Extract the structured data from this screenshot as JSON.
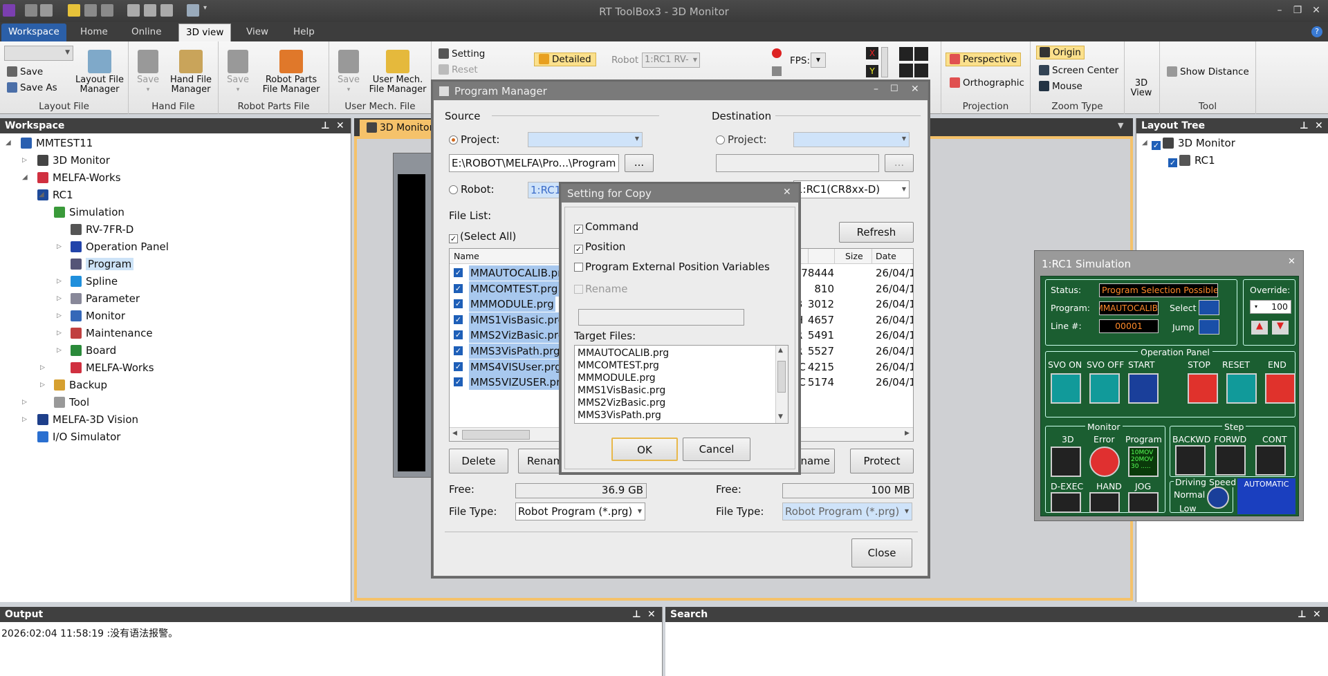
{
  "window": {
    "title": "RT ToolBox3 - 3D Monitor"
  },
  "menu": {
    "tabs": [
      "Workspace",
      "Home",
      "Online",
      "3D view",
      "View",
      "Help"
    ]
  },
  "ribbon": {
    "layout_file": {
      "save": "Save",
      "save_as": "Save As",
      "manager": "Layout File\nManager",
      "label": "Layout File"
    },
    "hand_file": {
      "save": "Save",
      "manager": "Hand File\nManager",
      "label": "Hand File"
    },
    "robot_parts": {
      "save": "Save",
      "manager": "Robot Parts\nFile Manager",
      "label": "Robot Parts File"
    },
    "user_mech": {
      "save": "Save",
      "manager": "User Mech.\nFile Manager",
      "label": "User Mech. File"
    },
    "setting": "Setting",
    "reset": "Reset",
    "detailed": "Detailed",
    "robot_label": "Robot",
    "robot_value": "1:RC1 RV-",
    "fps_label": "FPS:",
    "perspective": "Perspective",
    "orthographic": "Orthographic",
    "projection_label": "Projection",
    "origin": "Origin",
    "screen_center": "Screen Center",
    "mouse": "Mouse",
    "zoom_type_label": "Zoom Type",
    "view3d": "3D\nView",
    "show_distance": "Show Distance",
    "tool_label": "Tool"
  },
  "workspace": {
    "title": "Workspace",
    "items": [
      "MMTEST11",
      "3D Monitor",
      "MELFA-Works",
      "RC1",
      "Simulation",
      "RV-7FR-D",
      "Operation Panel",
      "Program",
      "Spline",
      "Parameter",
      "Monitor",
      "Maintenance",
      "Board",
      "MELFA-Works",
      "Backup",
      "Tool",
      "MELFA-3D Vision",
      "I/O Simulator"
    ]
  },
  "doc_tab": "3D Monitor",
  "layout_tree": {
    "title": "Layout Tree",
    "items": [
      "3D Monitor",
      "RC1"
    ]
  },
  "output": {
    "title": "Output",
    "line": "2026:02:04 11:58:19 :没有语法报警。"
  },
  "search": {
    "title": "Search"
  },
  "program_manager": {
    "title": "Program Manager",
    "source": "Source",
    "destination": "Destination",
    "project": "Project:",
    "robot": "Robot:",
    "source_path": "E:\\ROBOT\\MELFA\\Pro...\\Program",
    "source_robot": "1:RC1",
    "dest_robot": "1:RC1(CR8xx-D)",
    "browse": "...",
    "file_list": "File List:",
    "select_all": "(Select All)",
    "refresh": "Refresh",
    "col_name": "Name",
    "col_size": "Size",
    "col_date": "Date",
    "files": [
      {
        "name": "MMAUTOCALIB.prg",
        "mid": "",
        "size": "178444",
        "date": "26/04/15"
      },
      {
        "name": "MMCOMTEST.prg",
        "mid": "",
        "size": "810",
        "date": "26/04/15"
      },
      {
        "name": "MMMODULE.prg",
        "mid": "B",
        "size": "3012",
        "date": "26/04/15"
      },
      {
        "name": "MMS1VisBasic.prg",
        "mid": "H",
        "size": "4657",
        "date": "26/04/15"
      },
      {
        "name": "MMS2VizBasic.prg",
        "mid": "R",
        "size": "5491",
        "date": "26/04/15"
      },
      {
        "name": "MMS3VisPath.prg",
        "mid": "R",
        "size": "5527",
        "date": "26/04/15"
      },
      {
        "name": "MMS4VISUser.prg",
        "mid": "IC",
        "size": "4215",
        "date": "26/04/15"
      },
      {
        "name": "MMS5VIZUSER.prg",
        "mid": "IC",
        "size": "5174",
        "date": "26/04/15"
      }
    ],
    "delete": "Delete",
    "rename_left": "Renam",
    "rename_right": "ename",
    "protect": "Protect",
    "free": "Free:",
    "free_src": "36.9 GB",
    "free_dst": "100 MB",
    "file_type": "File Type:",
    "file_type_src": "Robot Program (*.prg)",
    "file_type_dst": "Robot Program (*.prg)",
    "close": "Close"
  },
  "copy_dialog": {
    "title": "Setting for Copy",
    "command": "Command",
    "position": "Position",
    "ext_pos": "Program External Position Variables",
    "rename": "Rename",
    "target_files": "Target Files:",
    "targets": [
      "MMAUTOCALIB.prg",
      "MMCOMTEST.prg",
      "MMMODULE.prg",
      "MMS1VisBasic.prg",
      "MMS2VizBasic.prg",
      "MMS3VisPath.prg"
    ],
    "ok": "OK",
    "cancel": "Cancel"
  },
  "simulation": {
    "title": "1:RC1  Simulation",
    "status_label": "Status:",
    "status_value": "Program Selection Possible",
    "program_label": "Program:",
    "program_value": "MMAUTOCALIB",
    "select": "Select",
    "line_label": "Line #:",
    "line_value": "00001",
    "jump": "Jump",
    "override_label": "Override:",
    "override_value": "100",
    "operation_panel": "Operation Panel",
    "svo_on": "SVO ON",
    "svo_off": "SVO OFF",
    "start": "START",
    "stop": "STOP",
    "reset": "RESET",
    "end": "END",
    "monitor": "Monitor",
    "m3d": "3D",
    "error": "Error",
    "program": "Program",
    "step": "Step",
    "backwd": "BACKWD",
    "forwd": "FORWD",
    "cont": "CONT",
    "dexec": "D-EXEC",
    "hand": "HAND",
    "jog": "JOG",
    "driving_speed": "Driving Speed",
    "normal": "Normal",
    "low": "Low",
    "automatic": "AUTOMATIC",
    "program_screen": "10MOV\n20MOV\n30 ....."
  }
}
